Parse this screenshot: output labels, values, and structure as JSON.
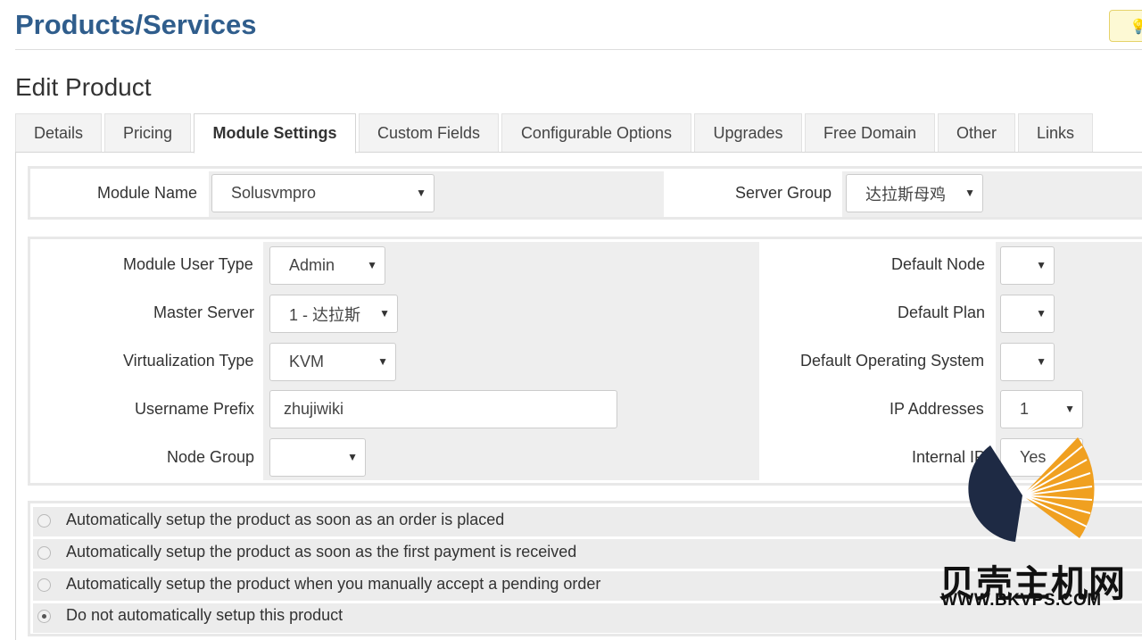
{
  "page": {
    "title": "Products/Services",
    "subtitle": "Edit Product"
  },
  "tabs": [
    {
      "label": "Details"
    },
    {
      "label": "Pricing"
    },
    {
      "label": "Module Settings"
    },
    {
      "label": "Custom Fields"
    },
    {
      "label": "Configurable Options"
    },
    {
      "label": "Upgrades"
    },
    {
      "label": "Free Domain"
    },
    {
      "label": "Other"
    },
    {
      "label": "Links"
    }
  ],
  "module": {
    "name_label": "Module Name",
    "name_value": "Solusvmpro",
    "server_group_label": "Server Group",
    "server_group_value": "达拉斯母鸡"
  },
  "settings": {
    "user_type_label": "Module User Type",
    "user_type_value": "Admin",
    "master_server_label": "Master Server",
    "master_server_value": "1 - 达拉斯",
    "virt_type_label": "Virtualization Type",
    "virt_type_value": "KVM",
    "username_prefix_label": "Username Prefix",
    "username_prefix_value": "zhujiwiki",
    "node_group_label": "Node Group",
    "node_group_value": "",
    "default_node_label": "Default Node",
    "default_node_value": "",
    "default_plan_label": "Default Plan",
    "default_plan_value": "",
    "default_os_label": "Default Operating System",
    "default_os_value": "",
    "ip_addresses_label": "IP Addresses",
    "ip_addresses_value": "1",
    "internal_ip_label": "Internal IP",
    "internal_ip_value": "Yes"
  },
  "setup_options": [
    {
      "label": "Automatically setup the product as soon as an order is placed",
      "checked": false
    },
    {
      "label": "Automatically setup the product as soon as the first payment is received",
      "checked": false
    },
    {
      "label": "Automatically setup the product when you manually accept a pending order",
      "checked": false
    },
    {
      "label": "Do not automatically setup this product",
      "checked": true
    }
  ],
  "watermark": {
    "text": "贝壳主机网",
    "url": "WWW.BKVPS.COM"
  },
  "icons": {
    "help": "lightbulb-icon",
    "dropdown": "caret-down-icon"
  },
  "colors": {
    "title": "#2f5d8c",
    "watermark_orange": "#f0a020",
    "watermark_navy": "#1e2a44"
  }
}
